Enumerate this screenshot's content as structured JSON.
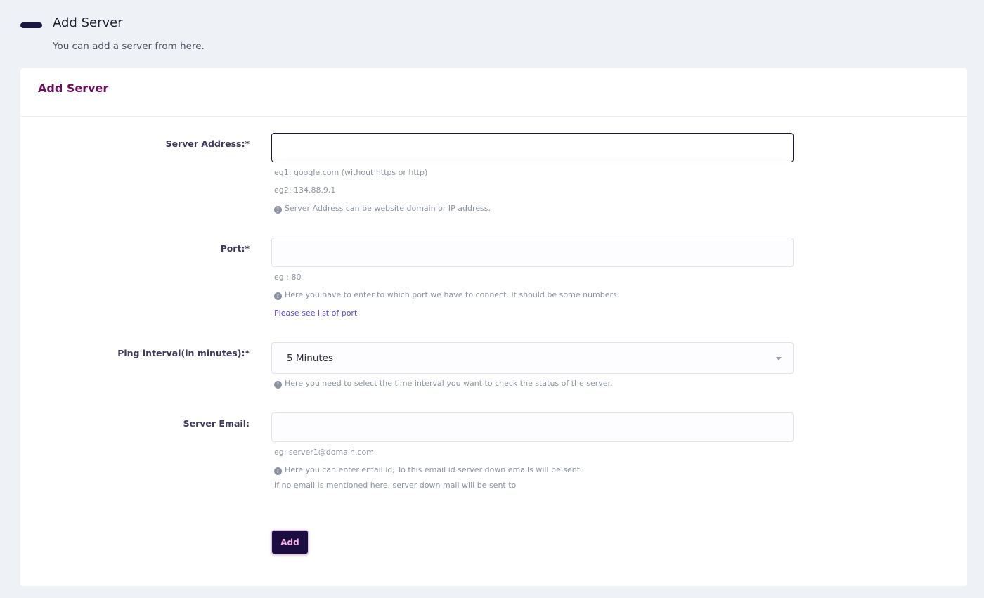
{
  "header": {
    "title": "Add Server",
    "subtitle": "You can add a server from here."
  },
  "card": {
    "title": "Add Server"
  },
  "form": {
    "server_address": {
      "label": "Server Address:*",
      "value": "",
      "hint1": "eg1: google.com (without https or http)",
      "hint2": "eg2: 134.88.9.1",
      "info": "Server Address can be website domain or IP address."
    },
    "port": {
      "label": "Port:*",
      "value": "",
      "hint": "eg : 80",
      "info": "Here you have to enter to which port we have to connect. It should be some numbers.",
      "link": "Please see list of port"
    },
    "ping_interval": {
      "label": "Ping interval(in minutes):*",
      "selected": "5 Minutes",
      "info": "Here you need to select the time interval you want to check the status of the server."
    },
    "server_email": {
      "label": "Server Email:",
      "value": "",
      "hint": "eg: server1@domain.com",
      "info": "Here you can enter email id, To this email id server down emails will be sent.",
      "note": "If no email is mentioned here, server down mail will be sent to"
    },
    "submit_label": "Add"
  },
  "colors": {
    "background": "#eef1f5",
    "card_title": "#6b1059",
    "button_bg": "#1b0d3f",
    "button_text": "#f3b0e4",
    "link": "#5c46d6"
  },
  "icons": {
    "info": "info-circle-icon",
    "select_caret": "caret-down-icon"
  }
}
